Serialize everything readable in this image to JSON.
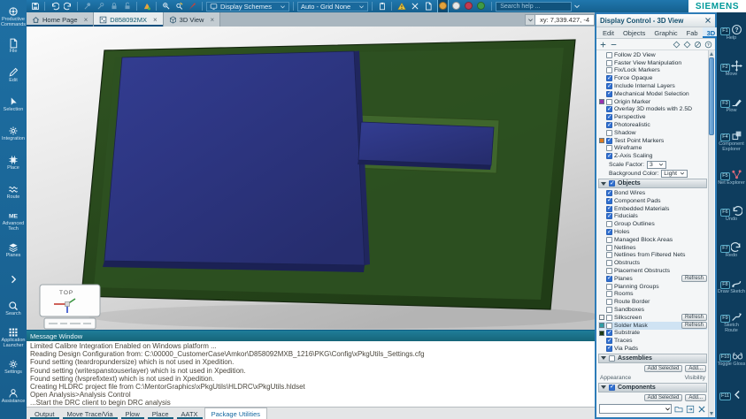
{
  "brand": {
    "logo": "SIEMENS"
  },
  "app": {
    "coordinate_readout": "xy: 7,339.427, -4",
    "close_glyph": "×"
  },
  "top_toolbar": {
    "display_schemes_label": "Display Schemes",
    "grid_value": "Auto - Grid None",
    "search_placeholder": "Search help ...",
    "icon_groups": [
      [
        {
          "name": "save-icon",
          "sym": "floppy"
        }
      ],
      [
        {
          "name": "undo-icon",
          "sym": "undo"
        },
        {
          "name": "redo-icon",
          "sym": "redo"
        }
      ],
      [
        {
          "name": "pin-icon",
          "sym": "pin",
          "dim": true
        },
        {
          "name": "pin-alt-icon",
          "sym": "pin2",
          "dim": true
        },
        {
          "name": "lock-icon",
          "sym": "lock",
          "dim": true
        },
        {
          "name": "lock-open-icon",
          "sym": "lockopen",
          "dim": true
        }
      ],
      [
        {
          "name": "highlight-flag-icon",
          "sym": "flag"
        }
      ],
      [
        {
          "name": "screwdriver-icon",
          "sym": "screw"
        },
        {
          "name": "screwdriver-edit-icon",
          "sym": "screw2"
        },
        {
          "name": "paintbrush-icon",
          "sym": "brush"
        }
      ]
    ],
    "right_icon_groups": [
      [
        {
          "name": "clipboard-icon",
          "sym": "clipboard"
        }
      ],
      [
        {
          "name": "warning-icon",
          "sym": "warn"
        },
        {
          "name": "measure-icon",
          "sym": "tools"
        },
        {
          "name": "report-icon",
          "sym": "doc"
        }
      ]
    ],
    "circle_toggles": [
      {
        "name": "display-toggle-orange",
        "color": "#e2a23c",
        "active": true
      },
      {
        "name": "display-toggle-white",
        "color": "#e6e8e8",
        "active": false
      },
      {
        "name": "display-toggle-red",
        "color": "#c23b52",
        "active": false
      },
      {
        "name": "display-toggle-green",
        "color": "#3f9b45",
        "active": false
      }
    ]
  },
  "document_tabs": [
    {
      "label": "Home Page",
      "icon": "home",
      "state": "underl"
    },
    {
      "label": "D858092MX",
      "icon": "design",
      "state": "underl current"
    },
    {
      "label": "3D View",
      "icon": "cube3d",
      "state": ""
    }
  ],
  "sidebar": {
    "items": [
      {
        "label": "Productive Commands",
        "icon": "gearwheel"
      },
      {
        "label": "File",
        "icon": "doc"
      },
      {
        "label": "Edit",
        "icon": "pencil"
      },
      {
        "label": "Selection",
        "icon": "cursor"
      },
      {
        "label": "Integration",
        "icon": "gear"
      },
      {
        "label": "Place",
        "icon": "chip"
      },
      {
        "label": "Route",
        "icon": "route"
      },
      {
        "label": "Advanced Tech",
        "icon": "adv"
      },
      {
        "label": "Planes",
        "icon": "layers"
      },
      {
        "label": "",
        "icon": "chevr"
      },
      {
        "label": "Search",
        "icon": "search"
      },
      {
        "label": "Application Launcher",
        "icon": "grid9"
      },
      {
        "label": "Settings",
        "icon": "gear"
      },
      {
        "label": "Assistance",
        "icon": "person"
      }
    ]
  },
  "right_toolbar": {
    "items": [
      {
        "label": "Help",
        "fkey": "F1",
        "icon": "help"
      },
      {
        "label": "Move",
        "fkey": "F2",
        "icon": "move"
      },
      {
        "label": "Plow",
        "fkey": "F3",
        "icon": "plow"
      },
      {
        "label": "Component Explorer",
        "fkey": "F4",
        "icon": "chipexp"
      },
      {
        "label": "Net Explorer",
        "fkey": "F5",
        "icon": "net"
      },
      {
        "label": "Undo",
        "fkey": "F6",
        "icon": "undo"
      },
      {
        "label": "Redo",
        "fkey": "F7",
        "icon": "redo"
      },
      {
        "label": "Draw Sketch",
        "fkey": "F8",
        "icon": "sketch"
      },
      {
        "label": "Sketch Route",
        "fkey": "F9",
        "icon": "sketchroute"
      },
      {
        "label": "Toggle Gloss",
        "fkey": "F10",
        "icon": "gloss"
      },
      {
        "label": "",
        "fkey": "F11",
        "icon": "chevl"
      }
    ]
  },
  "viewport": {
    "orientation_widget": {
      "label": "TOP"
    }
  },
  "display_control": {
    "title": "Display Control - 3D View",
    "tabs": [
      "Edit",
      "Objects",
      "Graphic",
      "Fab",
      "3D"
    ],
    "active_tab": "3D",
    "general_items": [
      {
        "label": "Follow 2D View",
        "checked": false
      },
      {
        "label": "Faster View Manipulation",
        "checked": false
      },
      {
        "label": "Fix/Lock Markers",
        "checked": false
      },
      {
        "label": "Force Opaque",
        "checked": true
      },
      {
        "label": "Include Internal Layers",
        "checked": true
      },
      {
        "label": "Mechanical Model Selection",
        "checked": true
      },
      {
        "label": "Origin Marker",
        "checked": false,
        "swatch": "#9b30b0"
      },
      {
        "label": "Overlay 3D models with 2.5D",
        "checked": true
      },
      {
        "label": "Perspective",
        "checked": true
      },
      {
        "label": "Photorealistic",
        "checked": true
      },
      {
        "label": "Shadow",
        "checked": false
      },
      {
        "label": "Test Point Markers",
        "checked": true,
        "swatch": "#de7a1e"
      },
      {
        "label": "Wireframe",
        "checked": false
      },
      {
        "label": "Z-Axis Scaling",
        "checked": true
      }
    ],
    "scale_factor": {
      "label": "Scale Factor:",
      "value": "3"
    },
    "background_color": {
      "label": "Background Color:",
      "value": "Light"
    },
    "refresh_label": "Refresh",
    "sections": {
      "objects": {
        "label": "Objects",
        "checked": true,
        "items": [
          {
            "label": "Bond Wires",
            "checked": true
          },
          {
            "label": "Component Pads",
            "checked": true
          },
          {
            "label": "Embedded Materials",
            "checked": true
          },
          {
            "label": "Fiducials",
            "checked": true
          },
          {
            "label": "Group Outlines",
            "checked": false
          },
          {
            "label": "Holes",
            "checked": true
          },
          {
            "label": "Managed Block Areas",
            "checked": false
          },
          {
            "label": "Netlines",
            "checked": false
          },
          {
            "label": "Netlines from Filtered Nets",
            "checked": false
          },
          {
            "label": "Obstructs",
            "checked": false
          },
          {
            "label": "Placement Obstructs",
            "checked": false
          },
          {
            "label": "Planes",
            "checked": true,
            "refresh": true
          },
          {
            "label": "Planning Groups",
            "checked": false
          },
          {
            "label": "Rooms",
            "checked": false
          },
          {
            "label": "Route Border",
            "checked": false
          },
          {
            "label": "Sandboxes",
            "checked": false
          },
          {
            "label": "Silkscreen",
            "checked": false,
            "swatch": "#f4f4f4",
            "refresh": true
          },
          {
            "label": "Solder Mask",
            "checked": false,
            "swatch": "#2f9ea6",
            "refresh": true,
            "highlight": true
          },
          {
            "label": "Substrate",
            "checked": true,
            "swatch": "#1d3a15"
          },
          {
            "label": "Traces",
            "checked": true
          },
          {
            "label": "Via Pads",
            "checked": true
          }
        ]
      },
      "assemblies": {
        "label": "Assemblies",
        "checked": false,
        "buttons": [
          "Add Selected",
          "Add..."
        ],
        "columns": [
          "Appearance",
          "Visibility"
        ]
      },
      "components": {
        "label": "Components",
        "checked": true,
        "buttons": [
          "Add Selected",
          "Add..."
        ]
      }
    }
  },
  "message_window": {
    "title": "Message Window",
    "lines": [
      "Limited Calibre Integration Enabled on Windows platform ...",
      "Reading Design Configuration from: C:\\00000_CustomerCase\\Amkor\\D858092MXB_1216\\PKG\\Config\\xPkgUtils_Settings.cfg",
      "Found setting (teardropundersize) which is not used in Xpedition.",
      "Found setting (writespanstouserlayer) which is not used in Xpedition.",
      "Found setting (lvsprefixtext) which is not used in Xpedition.",
      "Creating HLDRC project file from C:\\MentorGraphics\\xPkgUtils\\HLDRC\\xPkgUtils.hldset",
      "Open Analysis>Analysis Control",
      "...Start the DRC client to begin DRC analysis"
    ],
    "tabs": [
      {
        "label": "Output",
        "state": "underl"
      },
      {
        "label": "Move Trace/Via",
        "state": "underl"
      },
      {
        "label": "Plow",
        "state": "underl"
      },
      {
        "label": "Place",
        "state": "underl"
      },
      {
        "label": "AATX",
        "state": "underl"
      },
      {
        "label": "Package Utilities",
        "state": "current"
      }
    ]
  }
}
